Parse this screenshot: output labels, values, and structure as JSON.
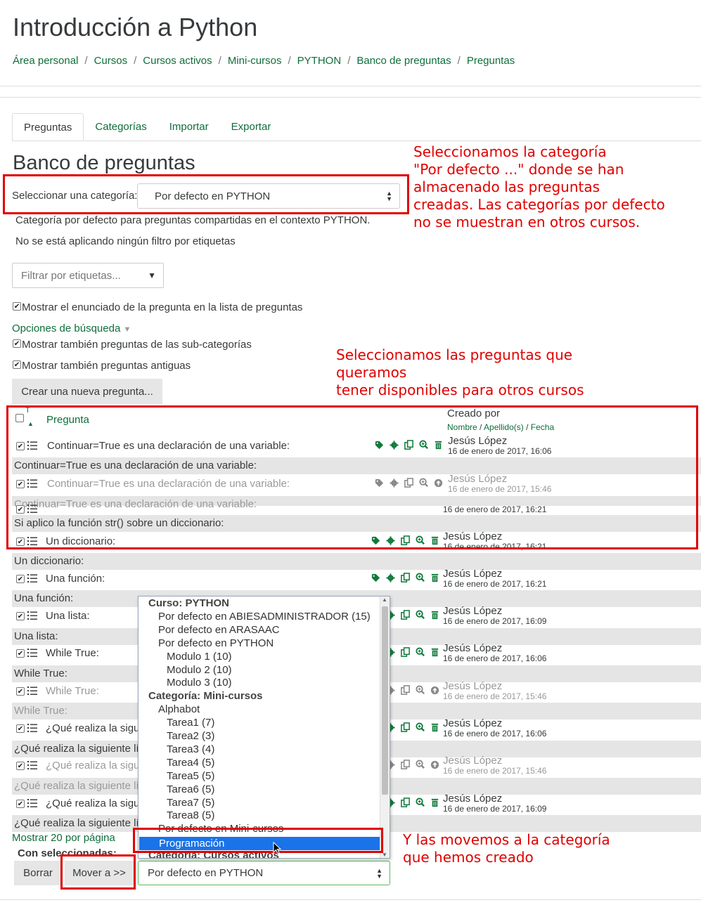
{
  "page_title": "Introducción a Python",
  "breadcrumb": [
    "Área personal",
    "Cursos",
    "Cursos activos",
    "Mini-cursos",
    "PYTHON",
    "Banco de preguntas",
    "Preguntas"
  ],
  "tabs": [
    "Preguntas",
    "Categorías",
    "Importar",
    "Exportar"
  ],
  "bank_heading": "Banco de preguntas",
  "category_label": "Seleccionar una categoría:",
  "category_value": "Por defecto en PYTHON",
  "category_info": "Categoría por defecto para preguntas compartidas en el contexto PYTHON.",
  "no_filter": "No se está aplicando ningún filtro por etiquetas",
  "tag_filter_placeholder": "Filtrar por etiquetas...",
  "show_text_label": "Mostrar el enunciado de la pregunta en la lista de preguntas",
  "search_options": "Opciones de búsqueda",
  "show_subcats_label": "Mostrar también preguntas de las sub-categorías",
  "show_old_label": "Mostrar también preguntas antiguas",
  "create_button": "Crear una nueva pregunta...",
  "table": {
    "type_header": "T",
    "question_header": "Pregunta",
    "created_by_header": "Creado por",
    "sort_first": "Nombre",
    "sort_last": "Apellido(s)",
    "sort_date": "Fecha",
    "sep": "/"
  },
  "rows": [
    {
      "name": "Continuar=True es una declaración de una variable:",
      "text": "Continuar=True es una declaración de una variable:",
      "author": "Jesús López",
      "date": "16 de enero de 2017, 16:06",
      "hidden": false
    },
    {
      "name": "Continuar=True es una declaración de una variable:",
      "text": "Continuar=True es una declaración de una variable:",
      "author": "Jesús López",
      "date": "16 de enero de 2017, 15:46",
      "hidden": true
    },
    {
      "name": "Si aplico la función str() sobre un diccionario:",
      "text": "Si aplico la función str() sobre un diccionario:",
      "author": "",
      "date": "16 de enero de 2017, 16:21",
      "hidden": false
    },
    {
      "name": "Un diccionario:",
      "text": "Un diccionario:",
      "author": "Jesús López",
      "date": "16 de enero de 2017, 16:21",
      "hidden": false
    },
    {
      "name": "Una función:",
      "text": "Una función:",
      "author": "Jesús López",
      "date": "16 de enero de 2017, 16:21",
      "hidden": false
    },
    {
      "name": "Una lista:",
      "text": "Una lista:",
      "author": "Jesús López",
      "date": "16 de enero de 2017, 16:09",
      "hidden": false
    },
    {
      "name": "While True:",
      "text": "While True:",
      "author": "Jesús López",
      "date": "16 de enero de 2017, 16:06",
      "hidden": false
    },
    {
      "name": "While True:",
      "text": "While True:",
      "author": "Jesús López",
      "date": "16 de enero de 2017, 15:46",
      "hidden": true
    },
    {
      "name": "¿Qué realiza la sigu",
      "text": "¿Qué realiza la siguiente lí",
      "author": "Jesús López",
      "date": "16 de enero de 2017, 16:06",
      "hidden": false
    },
    {
      "name": "¿Qué realiza la sigu",
      "text": "¿Qué realiza la siguiente lí",
      "author": "Jesús López",
      "date": "16 de enero de 2017, 15:46",
      "hidden": true
    },
    {
      "name": "¿Qué realiza la sigu",
      "text": "¿Qué realiza la siguiente lí",
      "author": "Jesús López",
      "date": "16 de enero de 2017, 16:09",
      "hidden": false
    }
  ],
  "show_per_page": "Mostrar 20 por página",
  "with_selected": "Con seleccionadas:",
  "delete_button": "Borrar",
  "move_button": "Mover a >>",
  "move_target": "Por defecto en PYTHON",
  "dropdown": [
    {
      "label": "Curso: PYTHON",
      "level": 0,
      "group": true
    },
    {
      "label": "Por defecto en ABIESADMINISTRADOR (15)",
      "level": 1
    },
    {
      "label": "Por defecto en ARASAAC",
      "level": 1
    },
    {
      "label": "Por defecto en PYTHON",
      "level": 1
    },
    {
      "label": "Modulo 1 (10)",
      "level": 2
    },
    {
      "label": "Modulo 2 (10)",
      "level": 2
    },
    {
      "label": "Modulo 3 (10)",
      "level": 2
    },
    {
      "label": "Categoría: Mini-cursos",
      "level": 0,
      "group": true
    },
    {
      "label": "Alphabot",
      "level": 1
    },
    {
      "label": "Tarea1 (7)",
      "level": 2
    },
    {
      "label": "Tarea2 (3)",
      "level": 2
    },
    {
      "label": "Tarea3 (4)",
      "level": 2
    },
    {
      "label": "Tarea4 (5)",
      "level": 2
    },
    {
      "label": "Tarea5 (5)",
      "level": 2
    },
    {
      "label": "Tarea6 (5)",
      "level": 2
    },
    {
      "label": "Tarea7 (5)",
      "level": 2
    },
    {
      "label": "Tarea8 (5)",
      "level": 2
    },
    {
      "label": "Por defecto en Mini-cursos",
      "level": 1
    },
    {
      "label": "Programación",
      "level": 1,
      "selected": true
    },
    {
      "label": "Categoría: Cursos activos",
      "level": 0,
      "group": true
    }
  ],
  "annotations": {
    "a1": "Seleccionamos la categoría\n\"Por defecto ...\" donde se han\nalmacenado las preguntas\ncreadas. Las categorías por defecto\nno se muestran en otros cursos.",
    "a2": "Seleccionamos las preguntas que\nqueramos\ntener disponibles para otros cursos",
    "a3": "Y las movemos a la categoría\nque hemos creado"
  },
  "colors": {
    "link": "#0f6e3a",
    "annotation": "#e00000",
    "selected": "#1a73e8"
  }
}
